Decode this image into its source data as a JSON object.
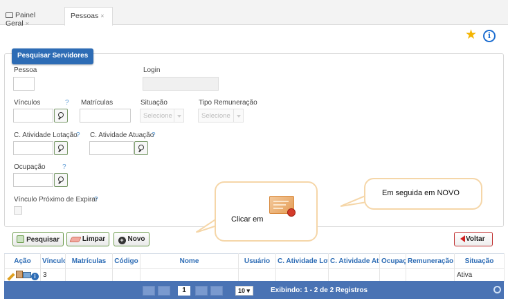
{
  "tabs": [
    {
      "label": "Painel Geral",
      "close": "×"
    },
    {
      "label": "Pessoas",
      "close": "×"
    }
  ],
  "panel": {
    "title": "Pesquisar Servidores",
    "fields": {
      "pessoa": "Pessoa",
      "login": "Login",
      "vinculos": "Vínculos",
      "matriculas": "Matrículas",
      "situacao": "Situação",
      "tipo_remuneracao": "Tipo Remuneração",
      "situacao_placeholder": "Selecione",
      "tipo_remuneracao_placeholder": "Selecione",
      "c_atividade_lotacao": "C. Atividade Lotação",
      "c_atividade_atuacao": "C. Atividade Atuação",
      "ocupacao": "Ocupação",
      "vinculo_proximo_expirar": "Vínculo Próximo de Expirar",
      "help": "?"
    }
  },
  "callouts": {
    "clicar_em": "Clicar em",
    "em_seguida": "Em seguida em NOVO"
  },
  "buttons": {
    "pesquisar": "Pesquisar",
    "limpar": "Limpar",
    "novo": "Novo",
    "voltar": "Voltar"
  },
  "table": {
    "columns": [
      "Ação",
      "Vínculos",
      "Matrículas",
      "Código",
      "Nome",
      "Usuário",
      "C. Atividade Lotação",
      "C. Atividade Atuação",
      "Ocupação",
      "Remuneração",
      "Situação"
    ],
    "rows": [
      {
        "vinculos": "3",
        "matriculas": "",
        "codigo": "",
        "nome": "",
        "usuario": "",
        "lotacao": "",
        "atuacao": "",
        "ocupacao": "",
        "remuneracao": "",
        "situacao": "Ativa"
      }
    ]
  },
  "pagination": {
    "current_page": "1",
    "per_page": "10",
    "summary": "Exibindo: 1 - 2 de 2 Registros"
  },
  "colors": {
    "accent": "#2d6cb5",
    "footer": "#4a73b4",
    "star": "#f4b400"
  }
}
